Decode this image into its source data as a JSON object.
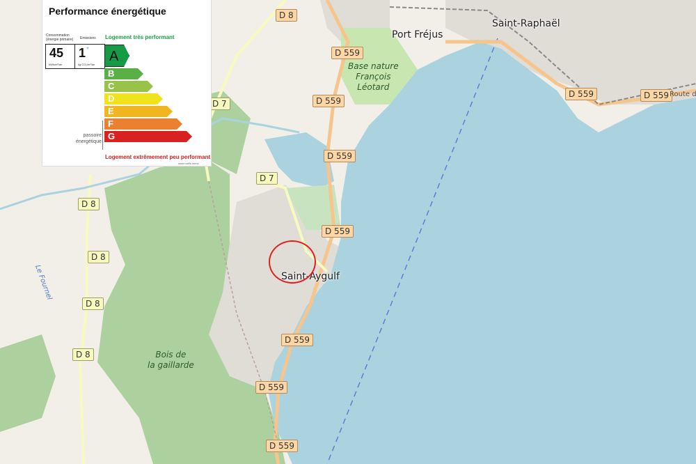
{
  "map": {
    "places": [
      {
        "name": "Port Fréjus",
        "kind": "town"
      },
      {
        "name": "Saint-Raphaël",
        "kind": "town"
      },
      {
        "name": "Saint-Aygulf",
        "kind": "town"
      },
      {
        "name": "Base nature\nFrançois\nLéotard",
        "kind": "park"
      },
      {
        "name": "Bois de\nla gaillarde",
        "kind": "park"
      },
      {
        "name": "Le Fournel",
        "kind": "stream"
      },
      {
        "name": "Route de",
        "kind": "route"
      }
    ],
    "roads": [
      "D 8",
      "D 559",
      "D 7"
    ]
  },
  "dpe": {
    "title": "Performance énergétique",
    "consumption_header": "Consommation\n(énergie primaire)",
    "emissions_header": "Emissions",
    "consumption_value": "45",
    "consumption_unit": "kWh/m²/an",
    "emissions_value": "1",
    "emissions_star": "*",
    "emissions_unit": "kg CO₂/m²/an",
    "best_label": "Logement très performant",
    "worst_label": "Logement extrêmement peu performant",
    "passoire_label": "passoire\nénergétique",
    "credit": "www.outils.immo",
    "current_class": "A",
    "classes": [
      {
        "letter": "A",
        "color": "#159a45"
      },
      {
        "letter": "B",
        "color": "#5ab046"
      },
      {
        "letter": "C",
        "color": "#99c24b"
      },
      {
        "letter": "D",
        "color": "#f0e21c"
      },
      {
        "letter": "E",
        "color": "#f1b51f"
      },
      {
        "letter": "F",
        "color": "#e98130"
      },
      {
        "letter": "G",
        "color": "#d7221f"
      }
    ]
  }
}
